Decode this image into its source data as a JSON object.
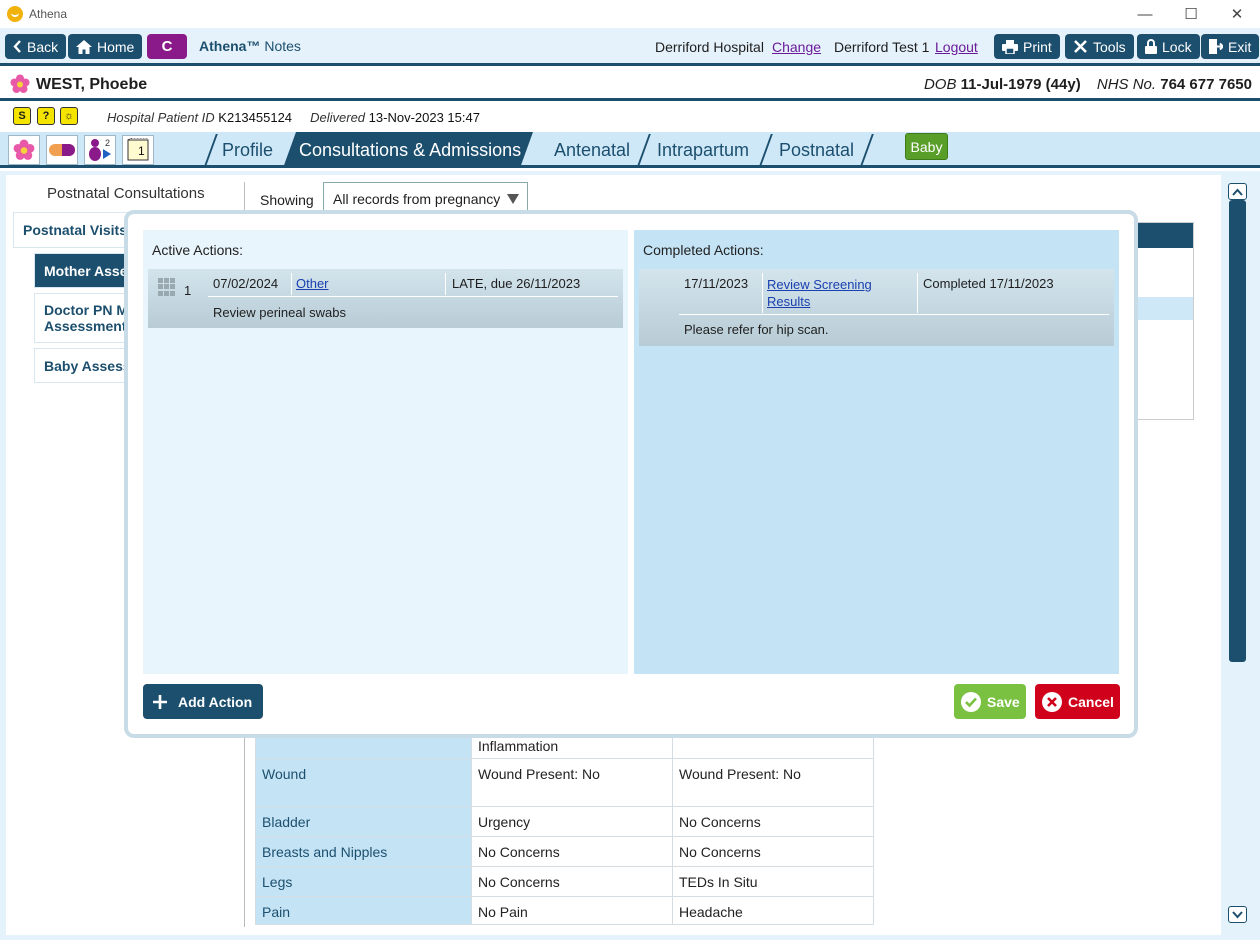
{
  "window": {
    "title": "Athena",
    "minimize": "—",
    "maximize": "☐",
    "close": "✕"
  },
  "toolbar": {
    "back": "Back",
    "home": "Home",
    "c_label": "C",
    "brand_main": "Athena™",
    "brand_sub": "Notes",
    "hospital": "Derriford Hospital",
    "change": "Change",
    "user": "Derriford Test 1",
    "logout": "Logout",
    "print": "Print",
    "tools": "Tools",
    "lock": "Lock",
    "exit": "Exit"
  },
  "patient": {
    "name": "WEST, Phoebe",
    "dob_label": "DOB",
    "dob": "11-Jul-1979 (44y)",
    "nhs_label": "NHS No.",
    "nhs": "764 677 7650",
    "hospital_id_label": "Hospital Patient ID",
    "hospital_id": "K213455124",
    "delivered_label": "Delivered",
    "delivered": "13-Nov-2023 15:47"
  },
  "badges": [
    "S",
    "?",
    "☼"
  ],
  "nav_icons": {
    "notes_count": "2",
    "card_number": "1"
  },
  "tabs": [
    {
      "label": "Profile",
      "active": false
    },
    {
      "label": "Consultations & Admissions",
      "active": true
    },
    {
      "label": "Antenatal",
      "active": false
    },
    {
      "label": "Intrapartum",
      "active": false
    },
    {
      "label": "Postnatal",
      "active": false
    }
  ],
  "baby_button": "Baby",
  "left_panel": {
    "title": "Postnatal Consultations",
    "items": [
      {
        "label": "Postnatal Visits"
      },
      {
        "label": "Mother Asse"
      },
      {
        "label": "Doctor PN M",
        "label2": "Assessments"
      },
      {
        "label": "Baby Assessi"
      }
    ]
  },
  "filter": {
    "label": "Showing",
    "value": "All records from pregnancy"
  },
  "modal": {
    "active": {
      "title": "Active Actions:",
      "items": [
        {
          "num": "1",
          "date": "07/02/2024",
          "type": "Other",
          "status": "LATE, due 26/11/2023",
          "note": "Review perineal swabs"
        }
      ]
    },
    "completed": {
      "title": "Completed Actions:",
      "items": [
        {
          "date": "17/11/2023",
          "type_line1": "Review Screening",
          "type_line2": "Results",
          "status": "Completed 17/11/2023",
          "note": "Please refer for hip scan."
        }
      ]
    },
    "add_action": "Add Action",
    "save": "Save",
    "cancel": "Cancel"
  },
  "assessment_table": [
    {
      "label": "",
      "col1": "Inflammation",
      "col2": ""
    },
    {
      "label": "Wound",
      "col1": "Wound Present: No",
      "col2": "Wound Present: No"
    },
    {
      "label": "Bladder",
      "col1": "Urgency",
      "col2": "No Concerns"
    },
    {
      "label": "Breasts and Nipples",
      "col1": "No Concerns",
      "col2": "No Concerns"
    },
    {
      "label": "Legs",
      "col1": "No Concerns",
      "col2": "TEDs In Situ"
    },
    {
      "label": "Pain",
      "col1": "No Pain",
      "col2": "Headache"
    }
  ]
}
